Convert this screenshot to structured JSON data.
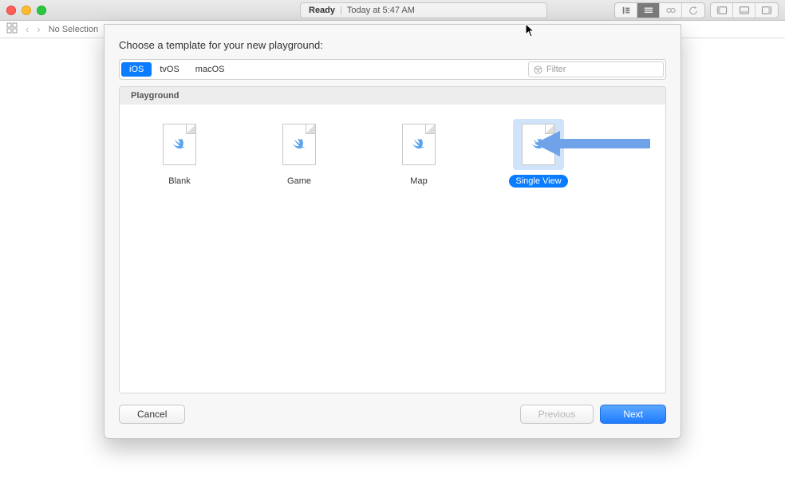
{
  "toolbar": {
    "status_ready": "Ready",
    "status_time": "Today at 5:47 AM"
  },
  "navbar": {
    "no_selection": "No Selection"
  },
  "sheet": {
    "title": "Choose a template for your new playground:",
    "platforms": [
      "iOS",
      "tvOS",
      "macOS"
    ],
    "active_platform_index": 0,
    "filter_placeholder": "Filter",
    "category": "Playground",
    "templates": [
      {
        "label": "Blank",
        "selected": false
      },
      {
        "label": "Game",
        "selected": false
      },
      {
        "label": "Map",
        "selected": false
      },
      {
        "label": "Single View",
        "selected": true
      }
    ],
    "buttons": {
      "cancel": "Cancel",
      "previous": "Previous",
      "next": "Next"
    }
  }
}
